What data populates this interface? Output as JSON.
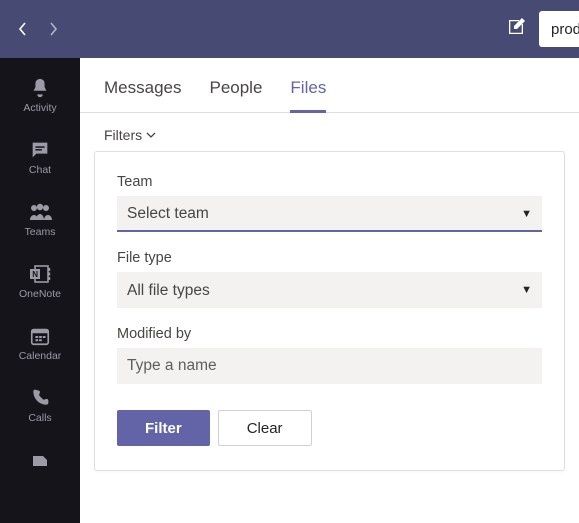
{
  "colors": {
    "brand": "#6264a7",
    "topbar": "#474a73",
    "rail": "#15141b"
  },
  "topbar": {
    "search_text": "prod"
  },
  "rail": {
    "items": [
      {
        "label": "Activity",
        "icon": "bell-icon"
      },
      {
        "label": "Chat",
        "icon": "chat-icon"
      },
      {
        "label": "Teams",
        "icon": "teams-icon"
      },
      {
        "label": "OneNote",
        "icon": "onenote-icon"
      },
      {
        "label": "Calendar",
        "icon": "calendar-icon"
      },
      {
        "label": "Calls",
        "icon": "phone-icon"
      }
    ]
  },
  "tabs": {
    "items": [
      {
        "label": "Messages"
      },
      {
        "label": "People"
      },
      {
        "label": "Files"
      }
    ],
    "active_index": 2
  },
  "filters_toggle_label": "Filters",
  "filters": {
    "team": {
      "label": "Team",
      "selected": "Select team"
    },
    "file_type": {
      "label": "File type",
      "selected": "All file types"
    },
    "modified_by": {
      "label": "Modified by",
      "placeholder": "Type a name",
      "value": ""
    },
    "filter_button": "Filter",
    "clear_button": "Clear"
  }
}
